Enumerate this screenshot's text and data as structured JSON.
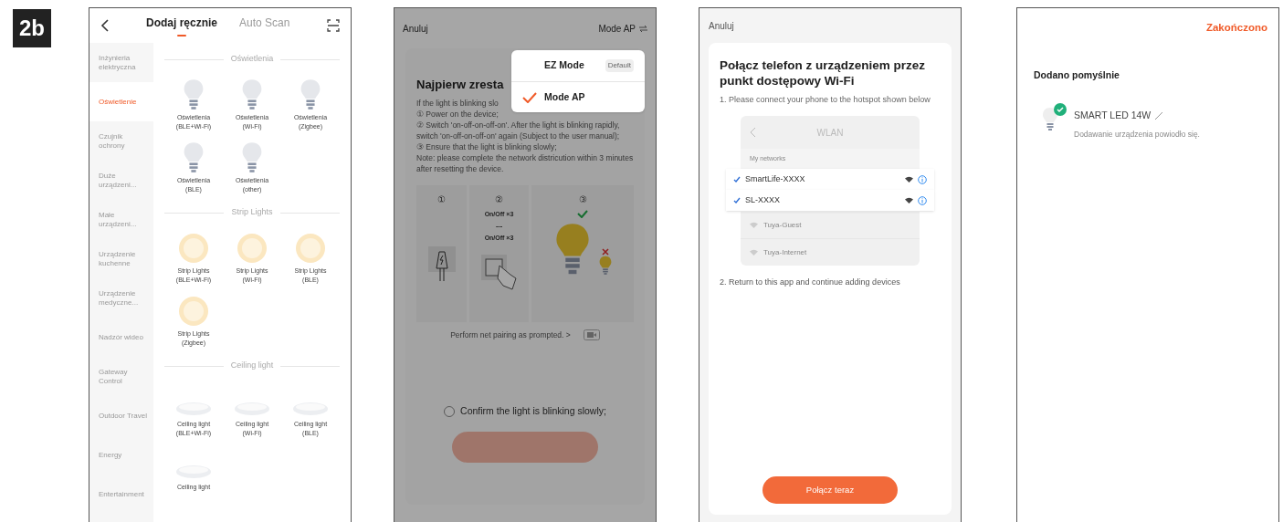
{
  "badge": "2b",
  "add_screen": {
    "tabs": [
      {
        "label": "Dodaj ręcznie",
        "selected": true
      },
      {
        "label": "Auto Scan",
        "selected": false
      }
    ],
    "categories": [
      {
        "label": "Inżynieria elektryczna",
        "selected": false
      },
      {
        "label": "Oświetlenie",
        "selected": true
      },
      {
        "label": "Czujnik ochrony",
        "selected": false
      },
      {
        "label": "Duże urządzeni...",
        "selected": false
      },
      {
        "label": "Małe urządzeni...",
        "selected": false
      },
      {
        "label": "Urządzenie kuchenne",
        "selected": false
      },
      {
        "label": "Urządzenie medyczne...",
        "selected": false
      },
      {
        "label": "Nadzór wideo",
        "selected": false
      },
      {
        "label": "Gateway Control",
        "selected": false
      },
      {
        "label": "Outdoor Travel",
        "selected": false
      },
      {
        "label": "Energy",
        "selected": false
      },
      {
        "label": "Entertainment",
        "selected": false
      }
    ],
    "sections": [
      {
        "title": "Oświetlenia",
        "items": [
          {
            "kind": "bulb",
            "name": "Oświetlenia",
            "variant": "(BLE+Wi-Fi)"
          },
          {
            "kind": "bulb",
            "name": "Oświetlenia",
            "variant": "(Wi-Fi)"
          },
          {
            "kind": "bulb",
            "name": "Oświetlenia",
            "variant": "(Zigbee)"
          },
          {
            "kind": "bulb",
            "name": "Oświetlenia",
            "variant": "(BLE)"
          },
          {
            "kind": "bulb",
            "name": "Oświetlenia",
            "variant": "(other)"
          }
        ]
      },
      {
        "title": "Strip Lights",
        "items": [
          {
            "kind": "strip",
            "name": "Strip Lights",
            "variant": "(BLE+Wi-Fi)"
          },
          {
            "kind": "strip",
            "name": "Strip Lights",
            "variant": "(Wi-Fi)"
          },
          {
            "kind": "strip",
            "name": "Strip Lights",
            "variant": "(BLE)"
          },
          {
            "kind": "strip",
            "name": "Strip Lights",
            "variant": "(Zigbee)"
          }
        ]
      },
      {
        "title": "Ceiling light",
        "items": [
          {
            "kind": "ceiling",
            "name": "Ceiling light",
            "variant": "(BLE+Wi-Fi)"
          },
          {
            "kind": "ceiling",
            "name": "Ceiling light",
            "variant": "(Wi-Fi)"
          },
          {
            "kind": "ceiling",
            "name": "Ceiling light",
            "variant": "(BLE)"
          },
          {
            "kind": "ceiling",
            "name": "Ceiling light"
          }
        ]
      }
    ]
  },
  "ap_screen": {
    "cancel": "Anuluj",
    "mode": "Mode AP",
    "heading": "Najpierw zresta",
    "intro": "If the light is blinking slo",
    "steps": [
      "① Power on the device;",
      "② Switch 'on-off-on-off-on'. After the light is blinking rapidly, switch 'on-off-on-off-on' again (Subject to the user manual);",
      "③ Ensure that the light is blinking slowly;",
      "Note: please complete the network districution within 3 minutes after resetting the device."
    ],
    "diagram_numbers": [
      "①",
      "②",
      "③"
    ],
    "switch_counts": [
      "On/Off ×3",
      "---",
      "On/Off ×3"
    ],
    "hint": "Perform net pairing as prompted. >",
    "confirm": {
      "label": "Confirm the light is blinking slowly;",
      "checked": false
    },
    "next_disabled": true,
    "menu": [
      {
        "label": "EZ Mode",
        "badge": "Default",
        "selected": false
      },
      {
        "label": "Mode AP",
        "selected": true
      }
    ]
  },
  "hotspot_screen": {
    "cancel": "Anuluj",
    "title": "Połącz telefon z urządzeniem przez punkt dostępowy Wi-Fi",
    "step1": "1. Please connect your phone to the hotspot shown below",
    "wlan": {
      "title": "WLAN",
      "section": "My networks",
      "networks": [
        {
          "name": "SmartLife-XXXX",
          "highlighted": true
        },
        {
          "name": "SL-XXXX",
          "highlighted": true
        },
        {
          "name": "Tuya-Guest",
          "highlighted": false
        },
        {
          "name": "Tuya-Internet",
          "highlighted": false
        }
      ]
    },
    "step2": "2. Return to this app and continue adding devices",
    "button": "Połącz teraz"
  },
  "done_screen": {
    "finish": "Zakończono",
    "heading": "Dodano pomyślnie",
    "device": {
      "name": "SMART LED 14W",
      "status": "Dodawanie urządzenia powiodło się.",
      "added": true
    }
  }
}
